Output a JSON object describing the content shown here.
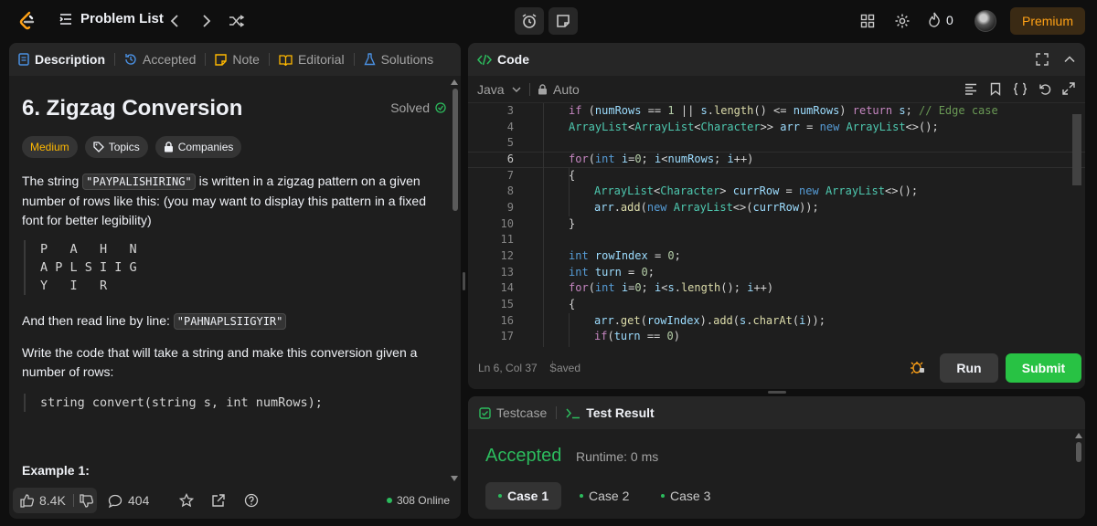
{
  "topnav": {
    "problem_list": "Problem List",
    "streak_count": "0",
    "premium": "Premium"
  },
  "left_panel": {
    "tabs": [
      "Description",
      "Accepted",
      "Note",
      "Editorial",
      "Solutions"
    ],
    "title": "6. Zigzag Conversion",
    "solved": "Solved",
    "pills": [
      "Medium",
      "Topics",
      "Companies"
    ],
    "para1_a": "The string ",
    "para1_code": "\"PAYPALISHIRING\"",
    "para1_b": " is written in a zigzag pattern on a given number of rows like this: (you may want to display this pattern in a fixed font for better legibility)",
    "zigzag": "P   A   H   N\nA P L S I I G\nY   I   R",
    "para2_a": "And then read line by line: ",
    "para2_code": "\"PAHNAPLSIIGYIR\"",
    "para3": "Write the code that will take a string and make this conversion given a number of rows:",
    "signature": "string convert(string s, int numRows);",
    "example": "Example 1:",
    "footer": {
      "likes": "8.4K",
      "comments": "404",
      "online": "308 Online"
    }
  },
  "code_panel": {
    "title": "Code",
    "language": "Java",
    "mode": "Auto",
    "line_numbers": [
      "3",
      "4",
      "5",
      "6",
      "7",
      "8",
      "9",
      "10",
      "11",
      "12",
      "13",
      "14",
      "15",
      "16",
      "17"
    ],
    "current_line": "6",
    "status": "Ln 6, Col 37",
    "saved": "Saved",
    "run": "Run",
    "submit": "Submit"
  },
  "test_panel": {
    "tabs": [
      "Testcase",
      "Test Result"
    ],
    "result": "Accepted",
    "runtime": "Runtime: 0 ms",
    "cases": [
      "Case 1",
      "Case 2",
      "Case 3"
    ]
  }
}
